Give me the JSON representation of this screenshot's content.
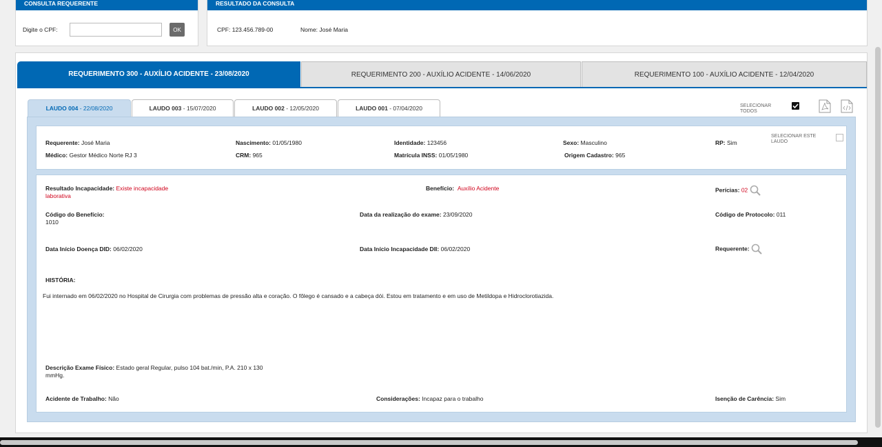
{
  "consulta": {
    "header": "CONSULTA REQUERENTE",
    "cpf_label": "Digite o CPF:",
    "cpf_value": "",
    "ok_label": "OK"
  },
  "resultado": {
    "header": "RESULTADO DA CONSULTA",
    "cpf": "CPF: 123.456.789-00",
    "nome": "Nome: José Maria"
  },
  "requerimentos": [
    {
      "label": "REQUERIMENTO 300 - AUXÍLIO ACIDENTE - 23/08/2020"
    },
    {
      "label": "REQUERIMENTO 200 - AUXÍLIO ACIDENTE - 14/06/2020"
    },
    {
      "label": "REQUERIMENTO 100 - AUXÍLIO ACIDENTE - 12/04/2020"
    }
  ],
  "laudos": [
    {
      "name": "LAUDO 004",
      "date": " - 22/08/2020"
    },
    {
      "name": "LAUDO 003",
      "date": " - 15/07/2020"
    },
    {
      "name": "LAUDO 002",
      "date": " - 12/05/2020"
    },
    {
      "name": "LAUDO 001",
      "date": " - 07/04/2020"
    }
  ],
  "select_all": {
    "line1": "SELECIONAR",
    "line2": "TODOS",
    "checked": true
  },
  "select_laudo": {
    "line1": "SELECIONAR ESTE",
    "line2": "LAUDO"
  },
  "requerente_info": {
    "requerente_label": "Requerente:",
    "requerente_value": "José Maria",
    "nascimento_label": "Nascimento:",
    "nascimento_value": "01/05/1980",
    "identidade_label": "Identidade:",
    "identidade_value": "123456",
    "sexo_label": "Sexo:",
    "sexo_value": "Masculino",
    "rp_label": "RP:",
    "rp_value": "Sim",
    "medico_label": "Médico:",
    "medico_value": "Gestor Médico Norte RJ 3",
    "crm_label": "CRM:",
    "crm_value": "965",
    "matricula_label": "Matrícula INSS:",
    "matricula_value": "01/05/1980",
    "origem_label": "Origem Cadastro:",
    "origem_value": "965"
  },
  "laudo_detail": {
    "resultado_label": "Resultado Incapacidade:",
    "resultado_value_1": "Existe incapacidade",
    "resultado_value_2": "laborativa",
    "beneficio_label": "Benefício:",
    "beneficio_value": "Auxílio Acidente",
    "pericias_label": "Perícias:",
    "pericias_value": "02",
    "codigo_beneficio_label": "Código do Benefício:",
    "codigo_beneficio_value": "1010",
    "data_exame_label": "Data da realização do exame:",
    "data_exame_value": "23/09/2020",
    "codigo_protocolo_label": "Código de Protocolo:",
    "codigo_protocolo_value": "011",
    "did_label": "Data Início Doença DID:",
    "did_value": "06/02/2020",
    "dii_label": "Data Início Incapacidade DII:",
    "dii_value": "06/02/2020",
    "requerente_label": "Requerente:",
    "historia_label": "HISTÓRIA:",
    "historia_text": "Fui internado em 06/02/2020 no Hospital de Cirurgia com problemas de pressão alta e coração. O fôlego é cansado e a cabeça dói. Estou em tratamento e em uso de Metildopa e Hidroclorotiazida.",
    "exame_label": "Descrição Exame Físico:",
    "exame_value_1": "Estado geral Regular, pulso 104 bat./min, P.A. 210 x 130",
    "exame_value_2": "mmHg.",
    "acidente_label": "Acidente de Trabalho:",
    "acidente_value": "Não",
    "consideracoes_label": "Considerações:",
    "consideracoes_value": "Incapaz para o trabalho",
    "isencao_label": "Isenção de Carência:",
    "isencao_value": "Sim"
  },
  "icons": {
    "search": "search-icon",
    "pdf": "pdf-icon",
    "xml": "code-file-icon"
  },
  "colors": {
    "primary": "#0068b4",
    "accent_red": "#d0021b",
    "card_border": "#b8cfe3"
  }
}
